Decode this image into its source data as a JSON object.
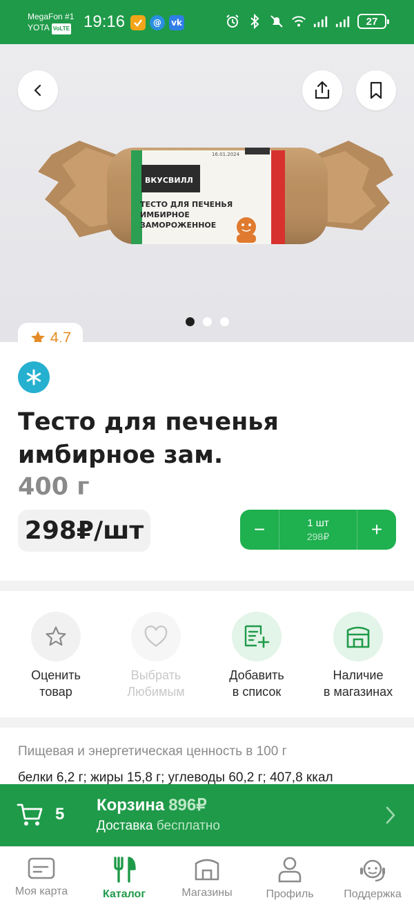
{
  "status_bar": {
    "carrier_1": "MegaFon #1",
    "carrier_2": "YOTA",
    "volte": "VoLTE",
    "time": "19:16",
    "battery": "27"
  },
  "product": {
    "rating": "4.7",
    "title": "Тесто для печенья имбирное зам.",
    "weight": "400 г",
    "price": "298₽/шт",
    "image_count": 3,
    "active_image": 1,
    "package": {
      "brand": "ВКУСВИЛЛ",
      "name_line1": "ТЕСТО ДЛЯ ПЕЧЕНЬЯ",
      "name_line2": "ИМБИРНОЕ",
      "name_line3": "ЗАМОРОЖЕННОЕ",
      "date": "16.01.2024"
    }
  },
  "cart_stepper": {
    "minus": "−",
    "plus": "+",
    "quantity": "1 шт",
    "subtotal": "298₽"
  },
  "actions": [
    {
      "line1": "Оценить",
      "line2": "товар",
      "enabled": true
    },
    {
      "line1": "Выбрать",
      "line2": "Любимым",
      "enabled": false
    },
    {
      "line1": "Добавить",
      "line2": "в список",
      "enabled": true
    },
    {
      "line1": "Наличие",
      "line2": "в магазинах",
      "enabled": true
    }
  ],
  "nutrition": {
    "heading": "Пищевая и энергетическая ценность в 100 г",
    "values": "белки 6,2 г; жиры 15,8 г; углеводы 60,2 г; 407,8 ккал"
  },
  "cart_bar": {
    "count": "5",
    "title": "Корзина",
    "total": "896₽",
    "delivery_label": "Доставка",
    "delivery_value": "бесплатно"
  },
  "bottom_nav": [
    {
      "label": "Моя карта",
      "icon": "card-icon",
      "active": false
    },
    {
      "label": "Каталог",
      "icon": "fork-knife-icon",
      "active": true
    },
    {
      "label": "Магазины",
      "icon": "store-icon",
      "active": false
    },
    {
      "label": "Профиль",
      "icon": "person-icon",
      "active": false
    },
    {
      "label": "Поддержка",
      "icon": "headset-icon",
      "active": false
    }
  ],
  "colors": {
    "brand_green": "#1f9a49",
    "button_green": "#1fb04f",
    "rating_orange": "#e58b25",
    "frozen_blue": "#26b0d0"
  }
}
